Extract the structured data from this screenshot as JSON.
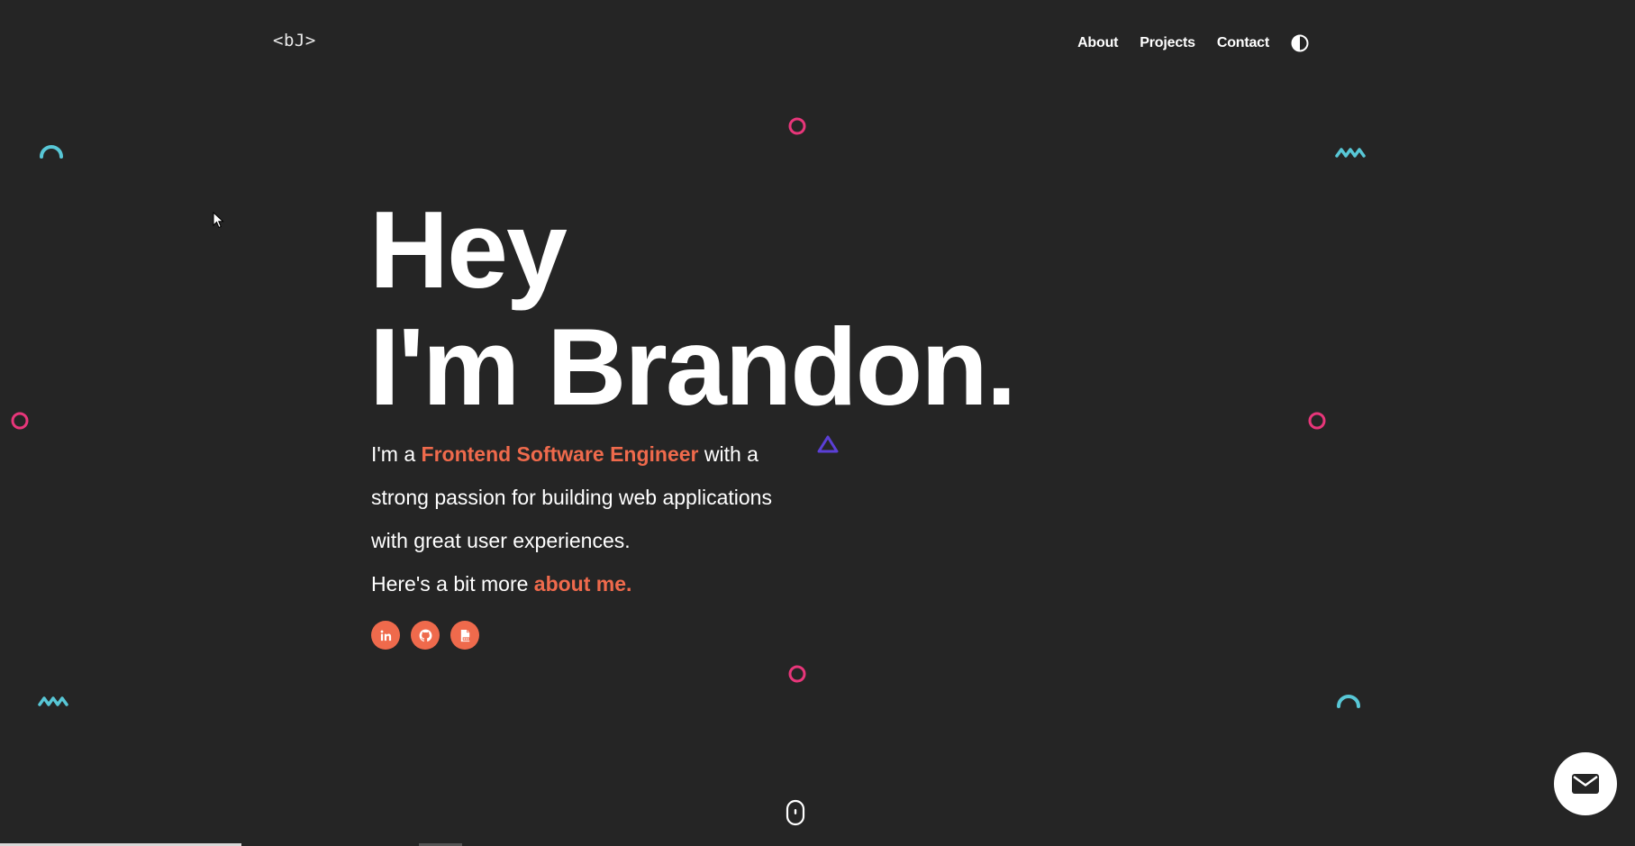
{
  "header": {
    "logo": "<bJ>",
    "nav": [
      {
        "label": "About"
      },
      {
        "label": "Projects"
      },
      {
        "label": "Contact"
      }
    ],
    "theme_toggle_icon": "contrast-icon"
  },
  "hero": {
    "title_line1": "Hey",
    "title_line2": "I'm Brandon.",
    "intro_prefix": "I'm a ",
    "intro_role": "Frontend Software Engineer",
    "intro_middle": " with a strong passion for building web applications with great user experiences.",
    "intro_more": "Here's a bit more ",
    "about_link": "about me."
  },
  "socials": [
    {
      "icon": "linkedin-icon"
    },
    {
      "icon": "github-icon"
    },
    {
      "icon": "resume-pdf-icon"
    }
  ],
  "colors": {
    "background": "#252525",
    "accent": "#ef6a4c",
    "pink": "#e8367a",
    "teal": "#58c7d6",
    "purple": "#5b3fd6"
  },
  "fab": {
    "icon": "mail-icon"
  },
  "scroll": {
    "icon": "mouse-scroll-icon"
  }
}
